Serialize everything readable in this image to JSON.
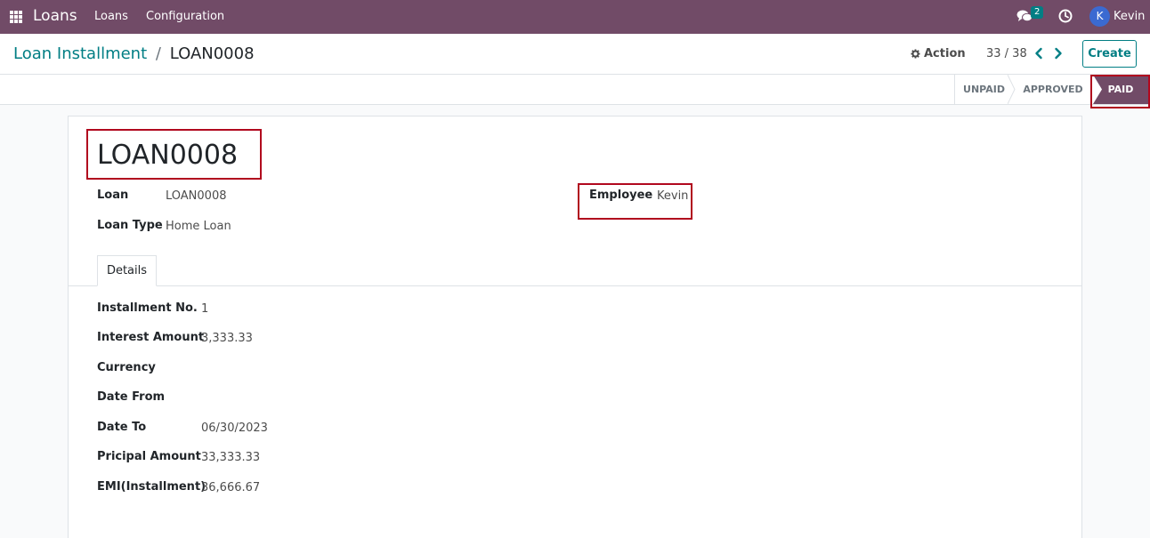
{
  "navbar": {
    "app_name": "Loans",
    "menu": [
      "Loans",
      "Configuration"
    ],
    "chat_count": "2",
    "user_initial": "K",
    "user_name": "Kevin"
  },
  "control": {
    "breadcrumb_parent": "Loan Installment",
    "breadcrumb_separator": "/",
    "breadcrumb_current": "LOAN0008",
    "action_label": "Action",
    "pager_value": "33 / 38",
    "create_label": "Create"
  },
  "statusbar": {
    "stages": [
      "UNPAID",
      "APPROVED",
      "PAID"
    ],
    "active_stage": "PAID"
  },
  "record": {
    "title": "LOAN0008",
    "loan_label": "Loan",
    "loan_value": "LOAN0008",
    "loan_type_label": "Loan Type",
    "loan_type_value": "Home Loan",
    "employee_label": "Employee",
    "employee_value": "Kevin"
  },
  "tabs": [
    "Details"
  ],
  "details": [
    {
      "label": "Installment No.",
      "value": "1"
    },
    {
      "label": "Interest Amount",
      "value": "3,333.33"
    },
    {
      "label": "Currency",
      "value": ""
    },
    {
      "label": "Date From",
      "value": ""
    },
    {
      "label": "Date To",
      "value": "06/30/2023"
    },
    {
      "label": "Pricipal Amount",
      "value": "33,333.33"
    },
    {
      "label": "EMI(Installment)",
      "value": "36,666.67"
    }
  ],
  "colors": {
    "brand": "#714b67",
    "accent": "#017e84",
    "highlight": "#b1081e"
  }
}
